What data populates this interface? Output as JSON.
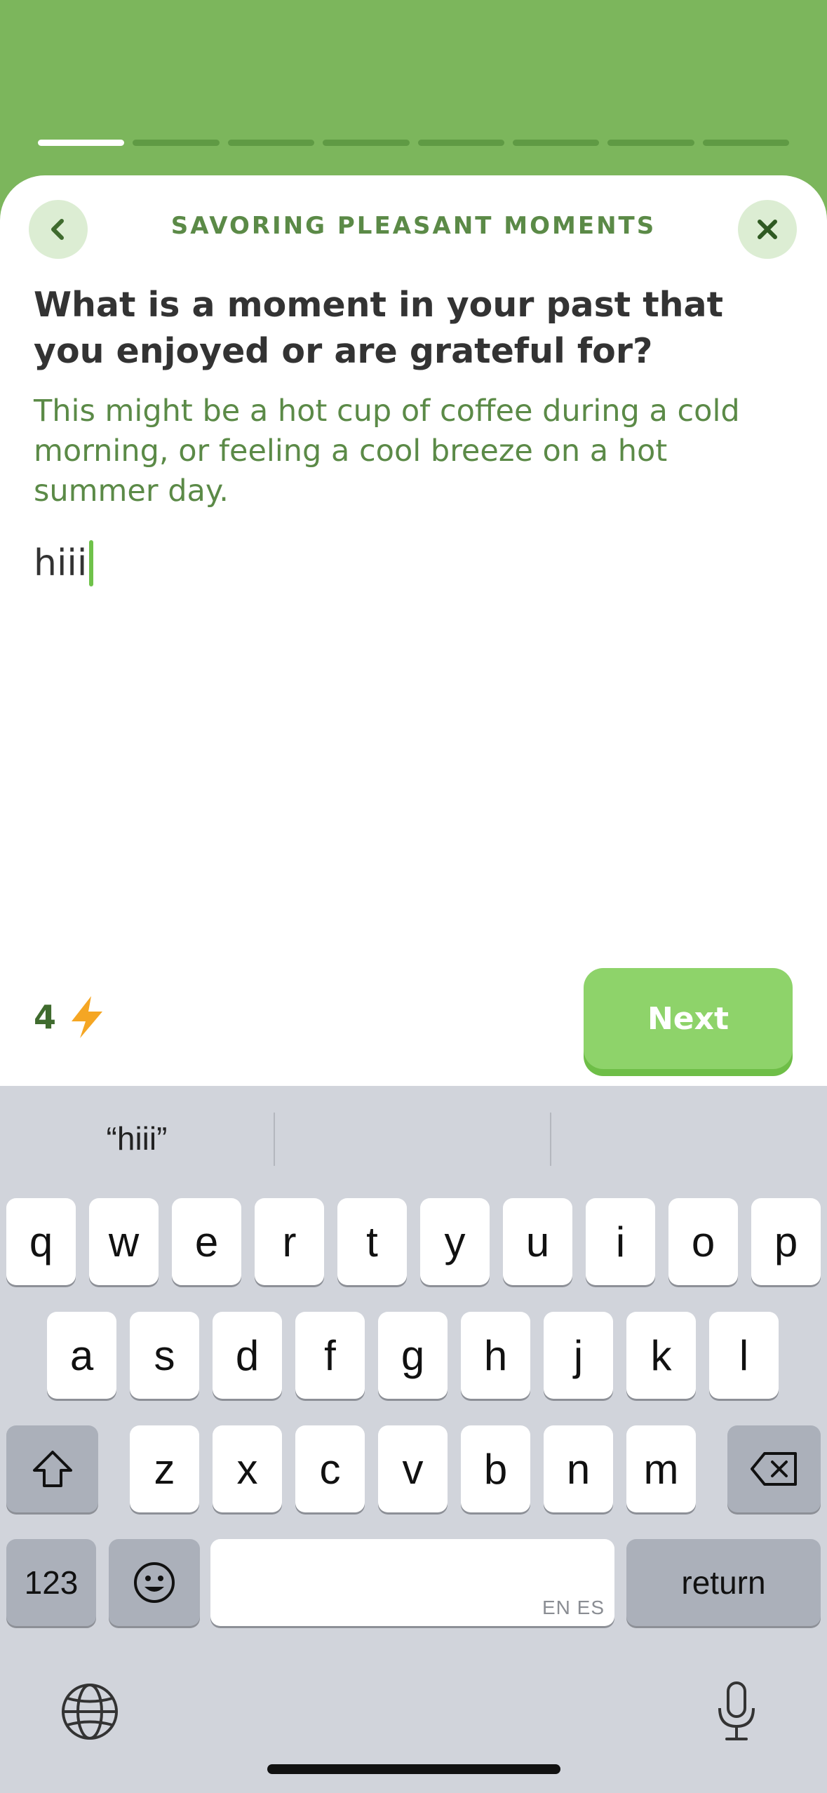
{
  "header": {
    "progress": {
      "total_steps": 8,
      "current_step": 1
    },
    "module_title": "SAVORING PLEASANT MOMENTS",
    "back_icon": "chevron-left-icon",
    "close_icon": "close-icon"
  },
  "prompt": {
    "question": "What is a moment in your past that you enjoyed or are grateful for?",
    "hint": "This might be a hot cup of coffee during a cold morning, or feeling a cool breeze on a hot summer day."
  },
  "answer": {
    "value": "hiii"
  },
  "footer": {
    "points": "4",
    "points_icon": "lightning-bolt-icon",
    "next_label": "Next"
  },
  "keyboard": {
    "suggestions": [
      "“hiii”",
      "",
      ""
    ],
    "row1": [
      "q",
      "w",
      "e",
      "r",
      "t",
      "y",
      "u",
      "i",
      "o",
      "p"
    ],
    "row2": [
      "a",
      "s",
      "d",
      "f",
      "g",
      "h",
      "j",
      "k",
      "l"
    ],
    "row3": [
      "z",
      "x",
      "c",
      "v",
      "b",
      "n",
      "m"
    ],
    "numbers_label": "123",
    "return_label": "return",
    "space_languages": "EN ES"
  },
  "colors": {
    "brand_green": "#7cb65c",
    "button_green": "#8ed36a",
    "text_green": "#5b8a47",
    "bolt_orange": "#f5a623"
  }
}
